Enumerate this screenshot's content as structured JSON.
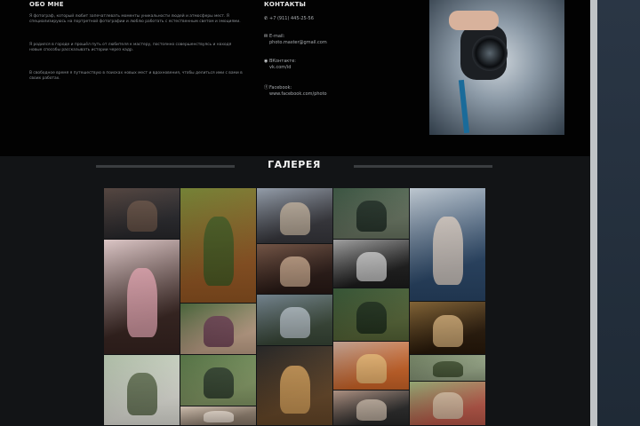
{
  "about": {
    "title": "ОБО МНЕ",
    "paragraphs": [
      "Я фотограф, который любит запечатлевать моменты уникальности людей и атмосферы мест. Я специализируюсь на портретной фотографии и люблю работать с естественным светом и эмоциями.",
      "Я родился в городе и прошёл путь от любителя к мастеру, постоянно совершенствуясь и находя новые способы рассказывать истории через кадр.",
      "В свободное время я путешествую в поисках новых мест и вдохновения, чтобы делиться ими с вами в своих работах."
    ]
  },
  "contacts": {
    "title": "КОНТАКТЫ",
    "items": [
      {
        "icon": "phone-icon",
        "glyph": "✆",
        "lines": [
          "+7 (911) 445-25-56"
        ]
      },
      {
        "icon": "mail-icon",
        "glyph": "✉",
        "lines": [
          "E-mail:",
          "photo.master@gmail.com"
        ]
      },
      {
        "icon": "vk-icon",
        "glyph": "◉",
        "lines": [
          "ВКонтакте:",
          "vk.com/id"
        ]
      },
      {
        "icon": "facebook-icon",
        "glyph": "ⓕ",
        "lines": [
          "Facebook:",
          "www.facebook.com/photo"
        ]
      }
    ]
  },
  "gallery": {
    "title": "ГАЛЕРЕЯ",
    "photos": [
      {
        "name": "photo-friends-bench",
        "colors": [
          "#4b3b35",
          "#2b2b2f",
          "#6b5548"
        ]
      },
      {
        "name": "photo-autumn-leaves",
        "colors": [
          "#6b7a2a",
          "#9a5a24",
          "#3f5a22"
        ]
      },
      {
        "name": "photo-couple-city",
        "colors": [
          "#8d97a4",
          "#3a3a40",
          "#c7b6a2"
        ]
      },
      {
        "name": "photo-bridge-forest",
        "colors": [
          "#2f4a36",
          "#6d7a66",
          "#1c2a22"
        ]
      },
      {
        "name": "photo-woman-rooftop",
        "colors": [
          "#b9c3cc",
          "#2c4a6d",
          "#e2d4c8"
        ]
      },
      {
        "name": "photo-woman-pink",
        "colors": [
          "#d9c2c2",
          "#3a2622",
          "#e8a8b4"
        ]
      },
      {
        "name": "photo-girls-laughing",
        "colors": [
          "#3c5a2e",
          "#c9a98f",
          "#6a3c52"
        ]
      },
      {
        "name": "photo-couple-embrace",
        "colors": [
          "#6a4a3a",
          "#2a1a16",
          "#c9a88d"
        ]
      },
      {
        "name": "photo-couple-bw",
        "colors": [
          "#9a9a9a",
          "#1e1e1e",
          "#d2d2d2"
        ]
      },
      {
        "name": "photo-woman-sunlight",
        "colors": [
          "#7a5a2a",
          "#2a1a0a",
          "#d8b27a"
        ]
      },
      {
        "name": "photo-mountain-lake",
        "colors": [
          "#6a7a86",
          "#3b4a3a",
          "#b7c2c9"
        ]
      },
      {
        "name": "photo-forest-walk",
        "colors": [
          "#2a4a2a",
          "#5a6a3a",
          "#1a2a1a"
        ]
      },
      {
        "name": "photo-green-valley",
        "colors": [
          "#4a6a3a",
          "#8aa06a",
          "#2a3a2a"
        ]
      },
      {
        "name": "photo-tent-night",
        "colors": [
          "#1a1a1a",
          "#6a4a2a",
          "#d8a25a"
        ]
      },
      {
        "name": "photo-glowing-jar",
        "colors": [
          "#b99a8a",
          "#d86a2a",
          "#f2c27a"
        ]
      },
      {
        "name": "photo-green-park",
        "colors": [
          "#6a7a5a",
          "#9aaa8a",
          "#3a4a2a"
        ]
      },
      {
        "name": "photo-birch-kids",
        "colors": [
          "#a8b8a0",
          "#e8e8e0",
          "#5a6a4a"
        ]
      },
      {
        "name": "photo-family-group",
        "colors": [
          "#a88a7a",
          "#2a2a2a",
          "#c9b8a8"
        ]
      },
      {
        "name": "photo-couple-field",
        "colors": [
          "#8aa06a",
          "#c05a4a",
          "#d8c2a8"
        ]
      },
      {
        "name": "photo-beach-people",
        "colors": [
          "#c9b8a8",
          "#8a7a6a",
          "#e8dcd0"
        ]
      }
    ]
  }
}
